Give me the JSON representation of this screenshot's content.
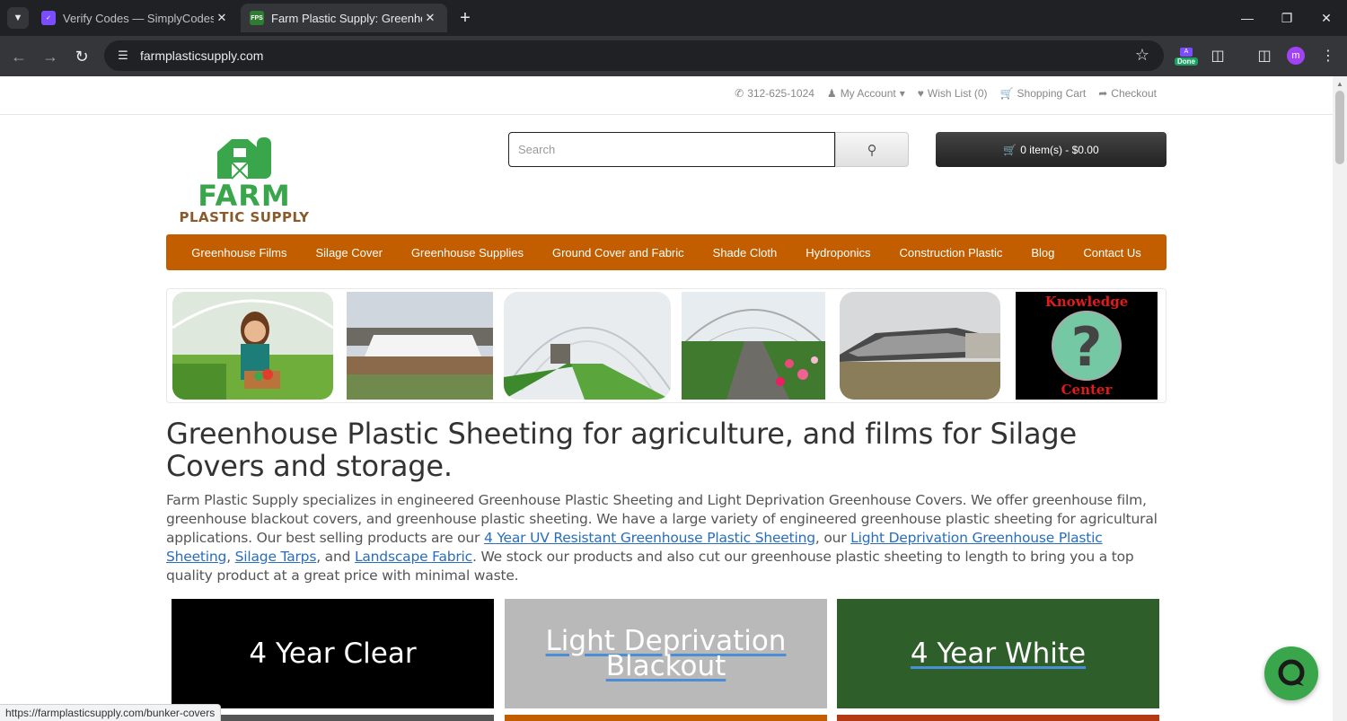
{
  "browser": {
    "tabs": [
      {
        "title": "Verify Codes — SimplyCodes",
        "active": false,
        "favicon": "simplycodes-icon"
      },
      {
        "title": "Farm Plastic Supply: Greenhouse",
        "active": true,
        "favicon": "fps-icon",
        "favicon_text": "FPS"
      }
    ],
    "url": "farmplasticsupply.com",
    "extension_badge_top": "A",
    "extension_badge": "Done",
    "profile_initial": "m",
    "status_url": "https://farmplasticsupply.com/bunker-covers"
  },
  "topbar": {
    "phone": "312-625-1024",
    "account": "My Account",
    "wishlist": "Wish List (0)",
    "cart": "Shopping Cart",
    "checkout": "Checkout"
  },
  "header": {
    "logo_alt": "Farm Plastic Supply",
    "search_placeholder": "Search",
    "cart_button": "0 item(s) - $0.00"
  },
  "nav": {
    "items": [
      "Greenhouse Films",
      "Silage Cover",
      "Greenhouse Supplies",
      "Ground Cover and Fabric",
      "Shade Cloth",
      "Hydroponics",
      "Construction Plastic",
      "Blog",
      "Contact Us"
    ]
  },
  "gallery": {
    "images": [
      "woman-greenhouse-image",
      "hoop-house-field-image",
      "greenhouse-interior-image",
      "greenhouse-flowers-image",
      "silage-bunker-image",
      "knowledge-center-image"
    ],
    "knowledge_top": "Knowledge",
    "knowledge_bottom": "Center"
  },
  "content": {
    "headline": "Greenhouse Plastic Sheeting for agriculture, and films for Silage Covers and storage.",
    "intro_1": "Farm Plastic Supply specializes in engineered Greenhouse Plastic Sheeting and Light Deprivation Greenhouse Covers. We offer greenhouse film, greenhouse blackout covers, and greenhouse plastic sheeting. We have a large variety of engineered greenhouse plastic sheeting for agricultural applications. Our best selling products are our ",
    "link_1": "4 Year UV Resistant Greenhouse Plastic Sheeting",
    "intro_2": ", our ",
    "link_2": "Light Deprivation Greenhouse Plastic Sheeting",
    "intro_3": ", ",
    "link_3": "Silage Tarps",
    "intro_4": ", and ",
    "link_4": "Landscape Fabric",
    "intro_5": ". We stock our products and also cut our greenhouse plastic sheeting to length to bring you a top quality product at a great price with minimal waste."
  },
  "tiles": [
    {
      "label": "4 Year Clear",
      "bg": "#000000"
    },
    {
      "label": "Light Deprivation Blackout",
      "bg": "#b9b9b9"
    },
    {
      "label": "4 Year White",
      "bg": "#2e5e2a"
    }
  ],
  "tiles_row2_colors": [
    "#555555",
    "#c25e00",
    "#b33a12"
  ],
  "colors": {
    "nav": "#c25e00",
    "chat": "#3aa64b"
  }
}
